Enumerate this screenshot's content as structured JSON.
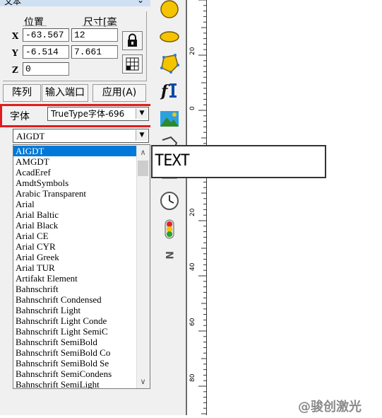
{
  "panel": {
    "title": "文本",
    "col_position": "位置",
    "col_size": "尺寸[毫",
    "rows": [
      {
        "label": "X",
        "pos": "-63.567",
        "size": "12"
      },
      {
        "label": "Y",
        "pos": "-6.514",
        "size": "7.661"
      },
      {
        "label": "Z",
        "pos": "0"
      }
    ],
    "tabs": [
      "阵列",
      "输入端口",
      "应用(A)"
    ],
    "font_label": "字体",
    "font_type_value": "TrueType字体-696",
    "font_name_value": "AIGDT",
    "font_list": [
      "AIGDT",
      "AMGDT",
      "AcadEref",
      "AmdtSymbols",
      "Arabic Transparent",
      "Arial",
      "Arial Baltic",
      "Arial Black",
      "Arial CE",
      "Arial CYR",
      "Arial Greek",
      "Arial TUR",
      "Artifakt Element",
      "Bahnschrift",
      "Bahnschrift Condensed",
      "Bahnschrift Light",
      "Bahnschrift Light Conde",
      "Bahnschrift Light SemiC",
      "Bahnschrift SemiBold",
      "Bahnschrift SemiBold Co",
      "Bahnschrift SemiBold Se",
      "Bahnschrift SemiCondens",
      "Bahnschrift SemiLight"
    ],
    "selected_font": "AIGDT"
  },
  "toolbar": {
    "icons": [
      "circle-icon",
      "ellipse-icon",
      "polygon-icon",
      "text-icon",
      "image-icon",
      "vector-file-icon",
      "delimiter-icon",
      "spiral-icon",
      "timer-icon",
      "signal-light-icon",
      "sequence-icon"
    ]
  },
  "ruler": {
    "labels": [
      "20",
      "0",
      "20",
      "40",
      "60",
      "80"
    ]
  },
  "canvas": {
    "text_object": "TEXT"
  },
  "watermark": "@骏创激光",
  "colors": {
    "highlight": "#e21c1c",
    "selection": "#0078d7",
    "shape_fill": "#f5c400"
  }
}
